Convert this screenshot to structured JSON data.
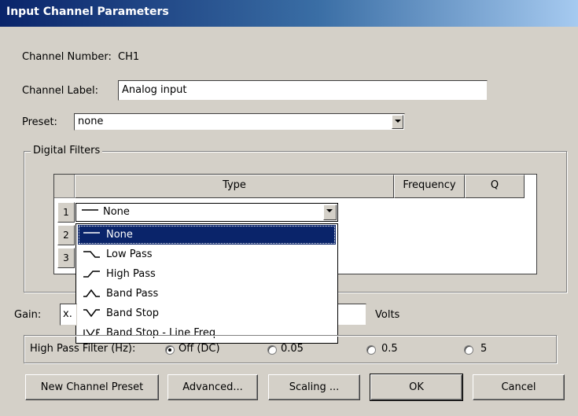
{
  "window": {
    "title": "Input Channel Parameters"
  },
  "channel_number": {
    "label": "Channel Number:",
    "value": "CH1"
  },
  "channel_label": {
    "label": "Channel Label:",
    "value": "Analog input"
  },
  "preset": {
    "label": "Preset:",
    "value": "none"
  },
  "digital_filters": {
    "legend": "Digital Filters",
    "columns": [
      "Type",
      "Frequency",
      "Q"
    ],
    "rows": [
      "1",
      "2",
      "3"
    ],
    "row1_type": "None",
    "dropdown_options": [
      "None",
      "Low Pass",
      "High Pass",
      "Band Pass",
      "Band Stop",
      "Band Stop - Line Freq"
    ],
    "selected_option": "None"
  },
  "gain": {
    "label": "Gain:",
    "value_fragment": "x.",
    "units": "Volts"
  },
  "high_pass_filter": {
    "label": "High Pass Filter (Hz):",
    "options": [
      "Off (DC)",
      "0.05",
      "0.5",
      "5"
    ],
    "selected": "Off (DC)"
  },
  "buttons": {
    "new_preset": "New Channel Preset",
    "advanced": "Advanced...",
    "scaling": "Scaling ...",
    "ok": "OK",
    "cancel": "Cancel"
  },
  "icons": [
    "filter-none-icon",
    "low-pass-icon",
    "high-pass-icon",
    "band-pass-icon",
    "band-stop-icon",
    "line-freq-icon"
  ]
}
